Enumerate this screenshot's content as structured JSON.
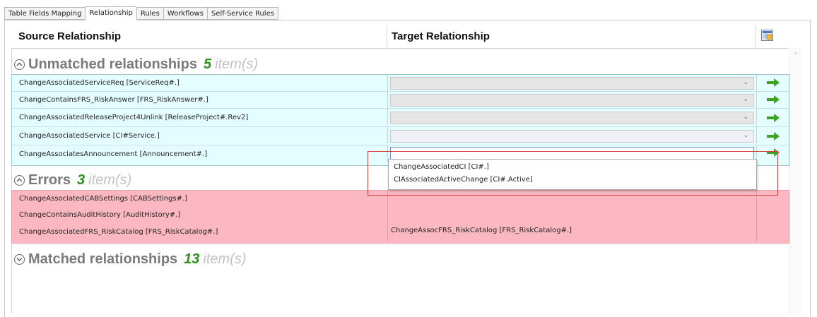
{
  "tabs": [
    {
      "label": "Table Fields Mapping",
      "active": false
    },
    {
      "label": "Relationship",
      "active": true
    },
    {
      "label": "Rules",
      "active": false
    },
    {
      "label": "Workflows",
      "active": false
    },
    {
      "label": "Self-Service Rules",
      "active": false
    }
  ],
  "header": {
    "source_label": "Source Relationship",
    "target_label": "Target Relationship",
    "grid_icon": "grid-settings-icon"
  },
  "groups": {
    "unmatched": {
      "title": "Unmatched relationships",
      "count": "5",
      "items_label": "item(s)",
      "expanded": true,
      "rows": [
        {
          "source": "ChangeAssociatedServiceReq [ServiceReq#.]",
          "target": ""
        },
        {
          "source": "ChangeContainsFRS_RiskAnswer [FRS_RiskAnswer#.]",
          "target": ""
        },
        {
          "source": "ChangeAssociatedReleaseProject4Unlink [ReleaseProject#.Rev2]",
          "target": ""
        },
        {
          "source": "ChangeAssociatedService [CI#Service.]",
          "target": ""
        },
        {
          "source": "ChangeAssociatesAnnouncement [Announcement#.]",
          "target": ""
        }
      ]
    },
    "errors": {
      "title": "Errors",
      "count": "3",
      "items_label": "item(s)",
      "expanded": true,
      "rows": [
        {
          "source": "ChangeAssociatedCABSettings [CABSettings#.]",
          "target": ""
        },
        {
          "source": "ChangeContainsAuditHistory [AuditHistory#.]",
          "target": ""
        },
        {
          "source": "ChangeAssociatedFRS_RiskCatalog [FRS_RiskCatalog#.]",
          "target": "ChangeAssocFRS_RiskCatalog [FRS_RiskCatalog#.]"
        }
      ]
    },
    "matched": {
      "title": "Matched relationships",
      "count": "13",
      "items_label": "item(s)",
      "expanded": false
    }
  },
  "dropdown": {
    "options": [
      "ChangeAssociatedCI [CI#.]",
      "CIAssociatedActiveChange [CI#.Active]"
    ]
  },
  "colors": {
    "unmatched_bg": "#e4fdfe",
    "error_bg": "#fbb8c3",
    "count_green": "#2f8f1f",
    "arrow_green": "#3aa521",
    "highlight_red": "#d93b3b"
  }
}
